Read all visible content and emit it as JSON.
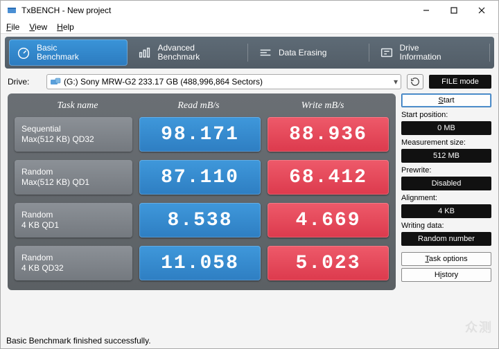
{
  "window": {
    "title": "TxBENCH - New project",
    "menus": {
      "file": "File",
      "view": "View",
      "help": "Help"
    }
  },
  "tabs": {
    "basic": "Basic\nBenchmark",
    "advanced": "Advanced\nBenchmark",
    "erase": "Data Erasing",
    "drive": "Drive\nInformation"
  },
  "driveRow": {
    "label": "Drive:",
    "selected": "(G:) Sony MRW-G2  233.17 GB (488,996,864 Sectors)",
    "fileMode": "FILE mode"
  },
  "bench": {
    "headers": {
      "task": "Task name",
      "read": "Read mB/s",
      "write": "Write mB/s"
    },
    "rows": [
      {
        "task1": "Sequential",
        "task2": "Max(512 KB) QD32",
        "read": "98.171",
        "write": "88.936"
      },
      {
        "task1": "Random",
        "task2": "Max(512 KB) QD1",
        "read": "87.110",
        "write": "68.412"
      },
      {
        "task1": "Random",
        "task2": "4 KB QD1",
        "read": "8.538",
        "write": "4.669"
      },
      {
        "task1": "Random",
        "task2": "4 KB QD32",
        "read": "11.058",
        "write": "5.023"
      }
    ]
  },
  "side": {
    "start": "Start",
    "startPosLabel": "Start position:",
    "startPos": "0 MB",
    "measLabel": "Measurement size:",
    "meas": "512 MB",
    "prewriteLabel": "Prewrite:",
    "prewrite": "Disabled",
    "alignLabel": "Alignment:",
    "align": "4 KB",
    "wdLabel": "Writing data:",
    "wd": "Random number",
    "taskOptions": "Task options",
    "history": "History"
  },
  "status": "Basic Benchmark finished successfully.",
  "chart_data": {
    "type": "table",
    "title": "TxBENCH Basic Benchmark – Sony MRW-G2 233.17 GB",
    "columns": [
      "Task name",
      "Read mB/s",
      "Write mB/s"
    ],
    "rows": [
      [
        "Sequential Max(512 KB) QD32",
        98.171,
        88.936
      ],
      [
        "Random Max(512 KB) QD1",
        87.11,
        68.412
      ],
      [
        "Random 4 KB QD1",
        8.538,
        4.669
      ],
      [
        "Random 4 KB QD32",
        11.058,
        5.023
      ]
    ]
  }
}
